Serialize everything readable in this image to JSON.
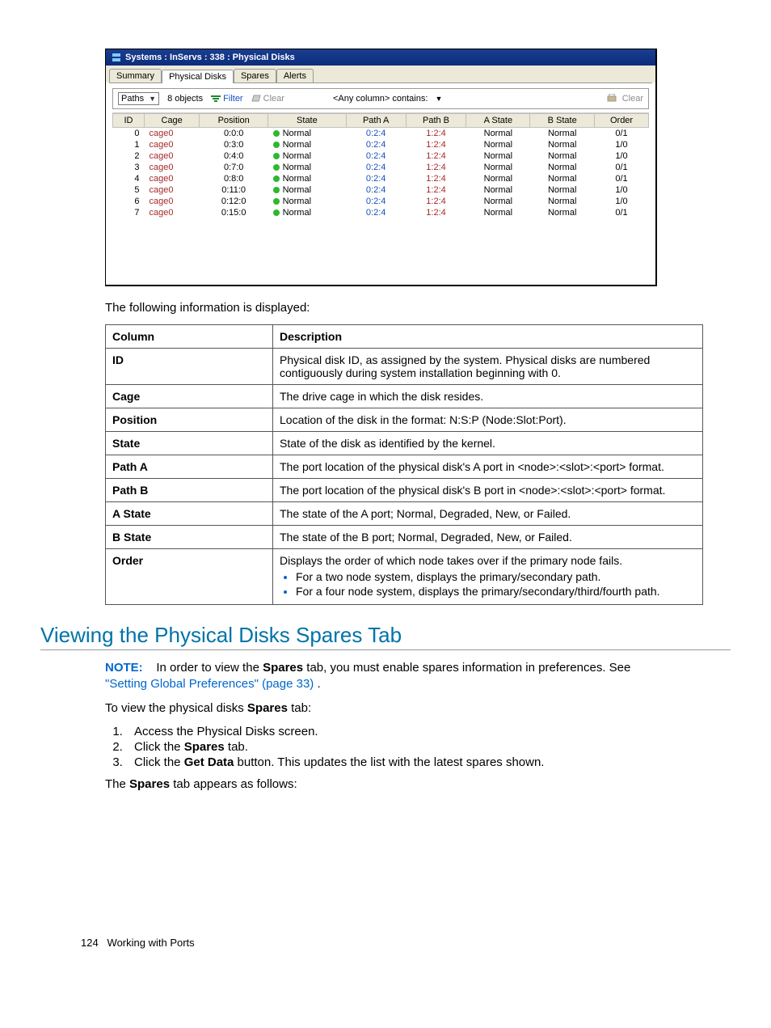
{
  "window": {
    "title": "Systems : InServs : 338 : Physical Disks",
    "tabs": [
      "Summary",
      "Physical Disks",
      "Spares",
      "Alerts"
    ],
    "active_tab_index": 1,
    "filterbar": {
      "dropdown_value": "Paths",
      "objects": "8 objects",
      "filter": "Filter",
      "clear": "Clear",
      "col_filter": "<Any column> contains:",
      "clear_right": "Clear"
    },
    "columns": [
      "ID",
      "Cage",
      "Position",
      "State",
      "Path A",
      "Path B",
      "A State",
      "B State",
      "Order"
    ],
    "rows": [
      {
        "id": "0",
        "cage": "cage0",
        "pos": "0:0:0",
        "state": "Normal",
        "pa": "0:2:4",
        "pb": "1:2:4",
        "as": "Normal",
        "bs": "Normal",
        "order": "0/1"
      },
      {
        "id": "1",
        "cage": "cage0",
        "pos": "0:3:0",
        "state": "Normal",
        "pa": "0:2:4",
        "pb": "1:2:4",
        "as": "Normal",
        "bs": "Normal",
        "order": "1/0"
      },
      {
        "id": "2",
        "cage": "cage0",
        "pos": "0:4:0",
        "state": "Normal",
        "pa": "0:2:4",
        "pb": "1:2:4",
        "as": "Normal",
        "bs": "Normal",
        "order": "1/0"
      },
      {
        "id": "3",
        "cage": "cage0",
        "pos": "0:7:0",
        "state": "Normal",
        "pa": "0:2:4",
        "pb": "1:2:4",
        "as": "Normal",
        "bs": "Normal",
        "order": "0/1"
      },
      {
        "id": "4",
        "cage": "cage0",
        "pos": "0:8:0",
        "state": "Normal",
        "pa": "0:2:4",
        "pb": "1:2:4",
        "as": "Normal",
        "bs": "Normal",
        "order": "0/1"
      },
      {
        "id": "5",
        "cage": "cage0",
        "pos": "0:11:0",
        "state": "Normal",
        "pa": "0:2:4",
        "pb": "1:2:4",
        "as": "Normal",
        "bs": "Normal",
        "order": "1/0"
      },
      {
        "id": "6",
        "cage": "cage0",
        "pos": "0:12:0",
        "state": "Normal",
        "pa": "0:2:4",
        "pb": "1:2:4",
        "as": "Normal",
        "bs": "Normal",
        "order": "1/0"
      },
      {
        "id": "7",
        "cage": "cage0",
        "pos": "0:15:0",
        "state": "Normal",
        "pa": "0:2:4",
        "pb": "1:2:4",
        "as": "Normal",
        "bs": "Normal",
        "order": "0/1"
      }
    ]
  },
  "intro": "The following information is displayed:",
  "desc": {
    "head_col": "Column",
    "head_desc": "Description",
    "rows": [
      {
        "c": "ID",
        "d": "Physical disk ID, as assigned by the system. Physical disks are numbered contiguously during system installation beginning with 0."
      },
      {
        "c": "Cage",
        "d": "The drive cage in which the disk resides."
      },
      {
        "c": "Position",
        "d": "Location of the disk in the format: N:S:P (Node:Slot:Port)."
      },
      {
        "c": "State",
        "d": "State of the disk as identified by the kernel."
      },
      {
        "c": "Path A",
        "d": "The port location of the physical disk's A port in <node>:<slot>:<port> format."
      },
      {
        "c": "Path B",
        "d": "The port location of the physical disk's B port in <node>:<slot>:<port> format."
      },
      {
        "c": "A State",
        "d": "The state of the A port; Normal, Degraded, New, or Failed."
      },
      {
        "c": "B State",
        "d": "The state of the B port; Normal, Degraded, New, or Failed."
      },
      {
        "c": "Order",
        "d": "Displays the order of which node takes over if the primary node fails.",
        "bullets": [
          "For a two node system, displays the primary/secondary path.",
          "For a four node system, displays the primary/secondary/third/fourth path."
        ]
      }
    ]
  },
  "heading": "Viewing the Physical Disks Spares Tab",
  "note": {
    "label": "NOTE:",
    "text_before": "In order to view the ",
    "bold1": "Spares",
    "text_mid": " tab, you must enable spares information in preferences. See ",
    "link": "\"Setting Global Preferences\" (page 33)",
    "text_after": " ."
  },
  "steps_intro_before": "To view the physical disks ",
  "steps_intro_bold": "Spares",
  "steps_intro_after": " tab:",
  "steps": [
    {
      "pre": "Access the Physical Disks screen."
    },
    {
      "pre": "Click the ",
      "b": "Spares",
      "post": " tab."
    },
    {
      "pre": "Click the ",
      "b": "Get Data",
      "post": " button. This updates the list with the latest spares shown."
    }
  ],
  "after_steps_before": "The ",
  "after_steps_bold": "Spares",
  "after_steps_after": " tab appears as follows:",
  "footer": {
    "page": "124",
    "chapter": "Working with Ports"
  }
}
